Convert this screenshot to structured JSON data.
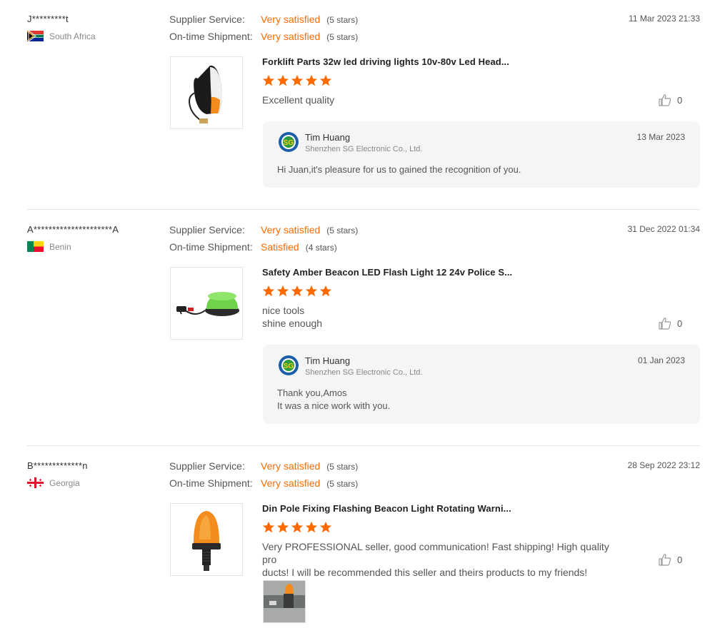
{
  "reviews": [
    {
      "user": "J*********t",
      "country": "South Africa",
      "supplier_label": "Supplier Service:",
      "supplier_text": "Very satisfied",
      "supplier_stars": "(5 stars)",
      "shipment_label": "On-time Shipment:",
      "shipment_text": "Very satisfied",
      "shipment_stars": "(5 stars)",
      "date": "11 Mar 2023 21:33",
      "product_title": "Forklift Parts 32w led driving lights 10v-80v Led Head...",
      "rating": 5,
      "comment_lines": [
        "Excellent quality"
      ],
      "likes": "0",
      "reply": {
        "name": "Tim Huang",
        "company": "Shenzhen SG Electronic Co., Ltd.",
        "date": "13 Mar 2023",
        "lines": [
          "Hi Juan,it's pleasure for us to gained the recognition of you."
        ]
      }
    },
    {
      "user": "A*********************A",
      "country": "Benin",
      "supplier_label": "Supplier Service:",
      "supplier_text": "Very satisfied",
      "supplier_stars": "(5 stars)",
      "shipment_label": "On-time Shipment:",
      "shipment_text": "Satisfied",
      "shipment_stars": "(4 stars)",
      "date": "31 Dec 2022 01:34",
      "product_title": "Safety Amber Beacon LED Flash Light 12 24v Police S...",
      "rating": 5,
      "comment_lines": [
        "nice tools",
        "shine enough"
      ],
      "likes": "0",
      "reply": {
        "name": "Tim Huang",
        "company": "Shenzhen SG Electronic Co., Ltd.",
        "date": "01 Jan 2023",
        "lines": [
          "Thank you,Amos",
          "It was a nice work with you."
        ]
      }
    },
    {
      "user": "B*************n",
      "country": "Georgia",
      "supplier_label": "Supplier Service:",
      "supplier_text": "Very satisfied",
      "supplier_stars": "(5 stars)",
      "shipment_label": "On-time Shipment:",
      "shipment_text": "Very satisfied",
      "shipment_stars": "(5 stars)",
      "date": "28 Sep 2022 23:12",
      "product_title": "Din Pole Fixing Flashing Beacon Light Rotating Warni...",
      "rating": 5,
      "comment_lines": [
        "Very PROFESSIONAL seller, good communication! Fast shipping! High quality pro",
        "ducts! I will be recommended this seller and theirs products to my friends!"
      ],
      "likes": "0"
    }
  ],
  "colors": {
    "accent": "#ff6a00",
    "star": "#ff6a00",
    "reply_bg": "#f5f5f5",
    "separator": "#e5e5e5"
  }
}
